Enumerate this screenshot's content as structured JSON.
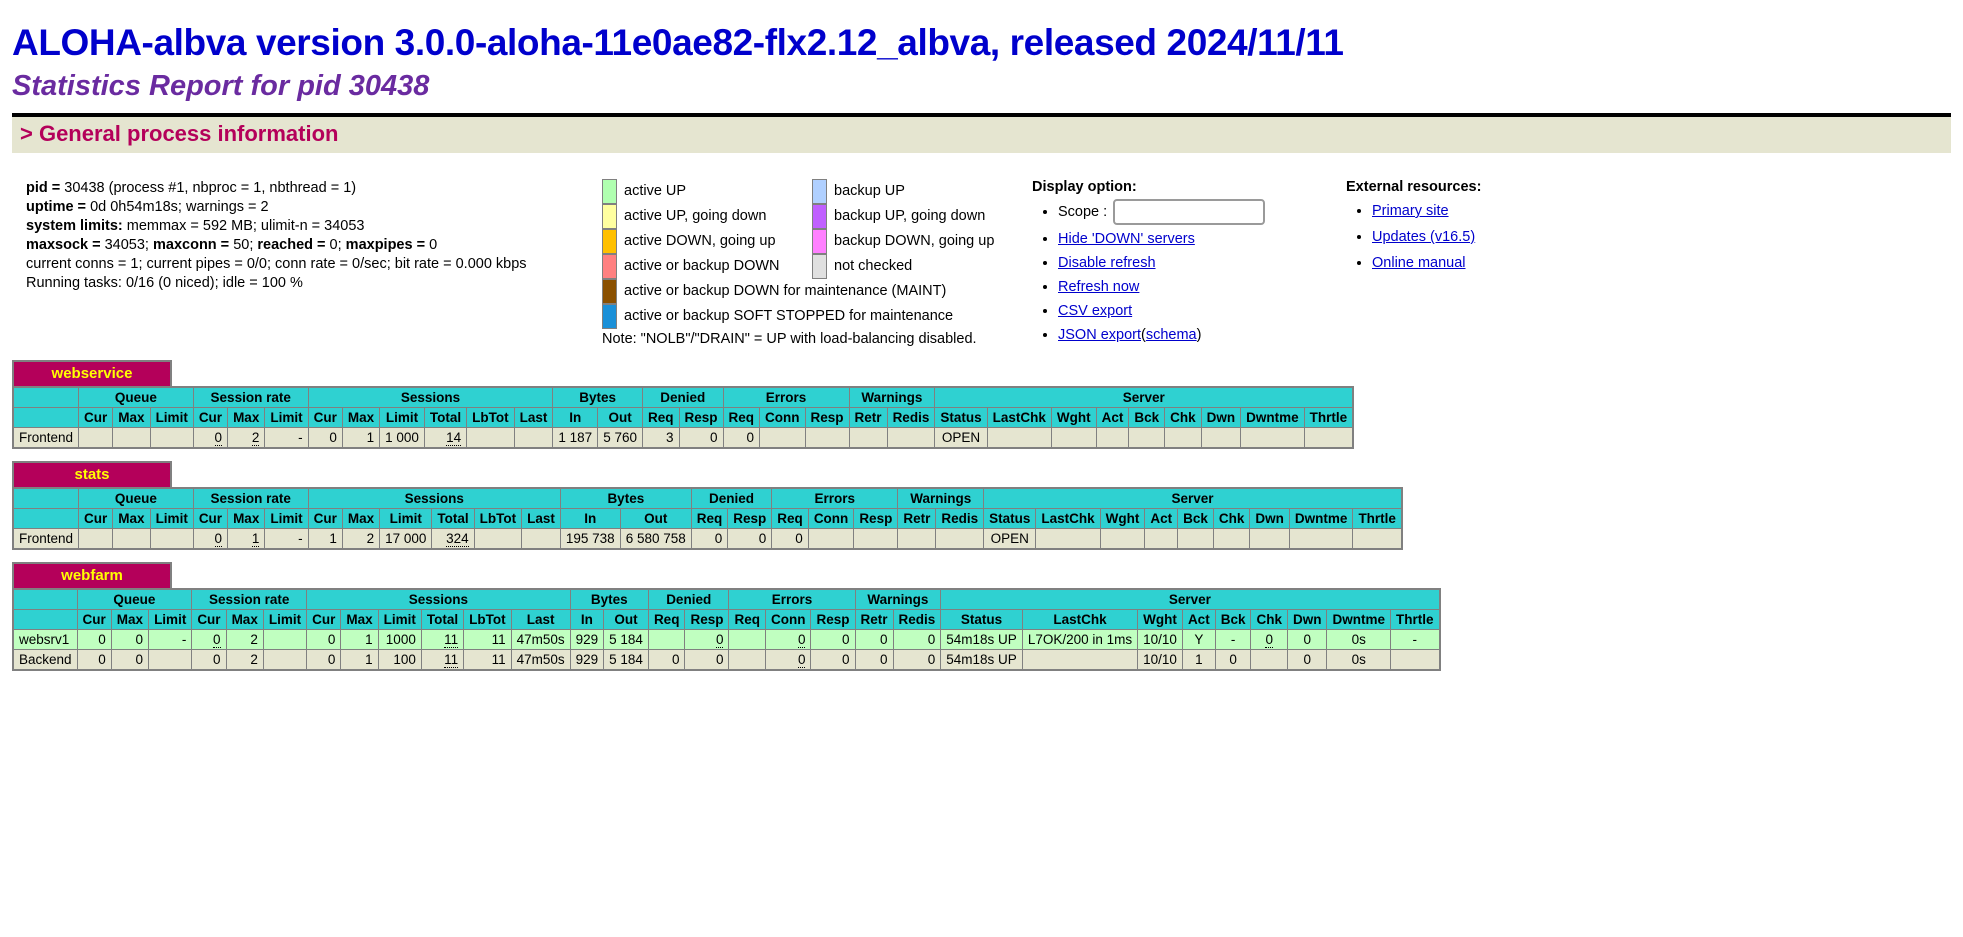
{
  "header": {
    "title": "ALOHA-albva version 3.0.0-aloha-11e0ae82-flx2.12_albva, released 2024/11/11",
    "subtitle": "Statistics Report for pid 30438"
  },
  "section": {
    "general_title": "> General process information"
  },
  "process_info": {
    "pid_label": "pid =",
    "pid_value": "30438 (process #1, nbproc = 1, nbthread = 1)",
    "uptime_label": "uptime =",
    "uptime_value": "0d 0h54m18s; warnings = 2",
    "system_limits_label": "system limits:",
    "system_limits_value": "memmax = 592 MB; ulimit-n = 34053",
    "maxsock_label": "maxsock =",
    "maxsock_value": "34053;",
    "maxconn_label": "maxconn =",
    "maxconn_value": "50;",
    "reached_label": "reached =",
    "reached_value": "0;",
    "maxpipes_label": "maxpipes =",
    "maxpipes_value": "0",
    "current_line": "current conns = 1; current pipes = 0/0; conn rate = 0/sec; bit rate = 0.000 kbps",
    "tasks_line": "Running tasks: 0/16 (0 niced); idle = 100 %"
  },
  "legend": {
    "left": [
      {
        "label": "active UP",
        "color": "#b0ffb0"
      },
      {
        "label": "active UP, going down",
        "color": "#ffffa0"
      },
      {
        "label": "active DOWN, going up",
        "color": "#ffc000"
      },
      {
        "label": "active or backup DOWN",
        "color": "#ff8080"
      },
      {
        "label": "active or backup DOWN for maintenance (MAINT)",
        "color": "#8a5000"
      },
      {
        "label": "active or backup SOFT STOPPED for maintenance",
        "color": "#1a90d8"
      }
    ],
    "right": [
      {
        "label": "backup UP",
        "color": "#b0d0ff"
      },
      {
        "label": "backup UP, going down",
        "color": "#c060ff"
      },
      {
        "label": "backup DOWN, going up",
        "color": "#ff80ff"
      },
      {
        "label": "not checked",
        "color": "#e0e0e0"
      }
    ],
    "note": "Note: \"NOLB\"/\"DRAIN\" = UP with load-balancing disabled."
  },
  "display_option": {
    "title": "Display option:",
    "scope_label": "Scope :",
    "scope_value": "",
    "scope_placeholder": "",
    "links": [
      "Hide 'DOWN' servers",
      "Disable refresh",
      "Refresh now",
      "CSV export",
      "JSON export"
    ],
    "json_schema_prefix": "(",
    "json_schema_link": "schema",
    "json_schema_suffix": ")"
  },
  "external": {
    "title": "External resources:",
    "links": [
      "Primary site",
      "Updates (v16.5)",
      "Online manual"
    ]
  },
  "group_headers": {
    "blank": "",
    "queue": "Queue",
    "session_rate": "Session rate",
    "sessions": "Sessions",
    "bytes": "Bytes",
    "denied": "Denied",
    "errors": "Errors",
    "warnings": "Warnings",
    "server": "Server"
  },
  "sub_headers": {
    "blank": "",
    "q_cur": "Cur",
    "q_max": "Max",
    "q_limit": "Limit",
    "sr_cur": "Cur",
    "sr_max": "Max",
    "sr_limit": "Limit",
    "s_cur": "Cur",
    "s_max": "Max",
    "s_limit": "Limit",
    "s_total": "Total",
    "s_lbtot": "LbTot",
    "s_last": "Last",
    "b_in": "In",
    "b_out": "Out",
    "d_req": "Req",
    "d_resp": "Resp",
    "e_req": "Req",
    "e_conn": "Conn",
    "e_resp": "Resp",
    "w_retr": "Retr",
    "w_redis": "Redis",
    "sv_status": "Status",
    "sv_lastchk": "LastChk",
    "sv_wght": "Wght",
    "sv_act": "Act",
    "sv_bck": "Bck",
    "sv_chk": "Chk",
    "sv_dwn": "Dwn",
    "sv_dwntme": "Dwntme",
    "sv_thrtle": "Thrtle"
  },
  "proxies": [
    {
      "name": "webservice",
      "rows": [
        {
          "kind": "frontend",
          "name": "Frontend",
          "q_cur": "",
          "q_max": "",
          "q_limit": "",
          "sr_cur": "0",
          "sr_max": "2",
          "sr_limit": "-",
          "s_cur": "0",
          "s_max": "1",
          "s_limit": "1 000",
          "s_total": "14",
          "s_lbtot": "",
          "s_last": "",
          "b_in": "1 187",
          "b_out": "5 760",
          "d_req": "3",
          "d_resp": "0",
          "e_req": "0",
          "e_conn": "",
          "e_resp": "",
          "w_retr": "",
          "w_redis": "",
          "sv_status": "OPEN",
          "sv_lastchk": "",
          "sv_wght": "",
          "sv_act": "",
          "sv_bck": "",
          "sv_chk": "",
          "sv_dwn": "",
          "sv_dwntme": "",
          "sv_thrtle": ""
        }
      ]
    },
    {
      "name": "stats",
      "rows": [
        {
          "kind": "frontend",
          "name": "Frontend",
          "q_cur": "",
          "q_max": "",
          "q_limit": "",
          "sr_cur": "0",
          "sr_max": "1",
          "sr_limit": "-",
          "s_cur": "1",
          "s_max": "2",
          "s_limit": "17 000",
          "s_total": "324",
          "s_lbtot": "",
          "s_last": "",
          "b_in": "195 738",
          "b_out": "6 580 758",
          "d_req": "0",
          "d_resp": "0",
          "e_req": "0",
          "e_conn": "",
          "e_resp": "",
          "w_retr": "",
          "w_redis": "",
          "sv_status": "OPEN",
          "sv_lastchk": "",
          "sv_wght": "",
          "sv_act": "",
          "sv_bck": "",
          "sv_chk": "",
          "sv_dwn": "",
          "sv_dwntme": "",
          "sv_thrtle": ""
        }
      ]
    },
    {
      "name": "webfarm",
      "rows": [
        {
          "kind": "server-up",
          "name": "websrv1",
          "q_cur": "0",
          "q_max": "0",
          "q_limit": "-",
          "sr_cur": "0",
          "sr_max": "2",
          "sr_limit": "",
          "s_cur": "0",
          "s_max": "1",
          "s_limit": "1000",
          "s_total": "11",
          "s_lbtot": "11",
          "s_last": "47m50s",
          "b_in": "929",
          "b_out": "5 184",
          "d_req": "",
          "d_resp": "0",
          "e_req": "",
          "e_conn": "0",
          "e_resp": "0",
          "w_retr": "0",
          "w_redis": "0",
          "sv_status": "54m18s UP",
          "sv_lastchk": "L7OK/200 in 1ms",
          "sv_wght": "10/10",
          "sv_act": "Y",
          "sv_bck": "-",
          "sv_chk": "0",
          "sv_dwn": "0",
          "sv_dwntme": "0s",
          "sv_thrtle": "-"
        },
        {
          "kind": "backend",
          "name": "Backend",
          "q_cur": "0",
          "q_max": "0",
          "q_limit": "",
          "sr_cur": "0",
          "sr_max": "2",
          "sr_limit": "",
          "s_cur": "0",
          "s_max": "1",
          "s_limit": "100",
          "s_total": "11",
          "s_lbtot": "11",
          "s_last": "47m50s",
          "b_in": "929",
          "b_out": "5 184",
          "d_req": "0",
          "d_resp": "0",
          "e_req": "",
          "e_conn": "0",
          "e_resp": "0",
          "w_retr": "0",
          "w_redis": "0",
          "sv_status": "54m18s UP",
          "sv_lastchk": "",
          "sv_wght": "10/10",
          "sv_act": "1",
          "sv_bck": "0",
          "sv_chk": "",
          "sv_dwn": "0",
          "sv_dwntme": "0s",
          "sv_thrtle": ""
        }
      ]
    }
  ],
  "colors": {
    "title_blue": "#0000cc",
    "subtitle_purple": "#6a2ba0",
    "section_crimson": "#b4005a",
    "header_turquoise": "#2fd1d1",
    "row_beige": "#e5e5d0",
    "row_green": "#c0ffc0"
  }
}
